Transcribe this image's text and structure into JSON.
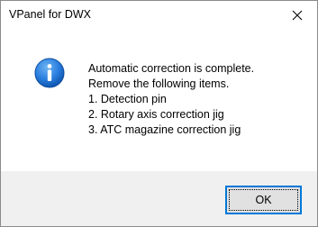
{
  "window": {
    "title": "VPanel for DWX"
  },
  "dialog": {
    "icon": "info-icon",
    "message_lines": [
      "Automatic correction is complete.",
      "Remove the following items.",
      "1. Detection pin",
      "2. Rotary axis correction jig",
      "3. ATC magazine correction jig"
    ]
  },
  "buttons": {
    "ok_label": "OK"
  },
  "colors": {
    "titlebar_bg": "#ffffff",
    "content_bg": "#ffffff",
    "footer_bg": "#f0f0f0",
    "button_border_focus": "#0078d7",
    "info_icon_fill": "#1e6fd0"
  }
}
